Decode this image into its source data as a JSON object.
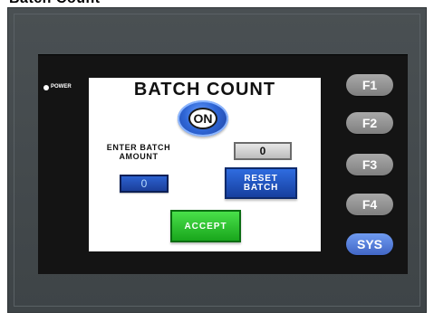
{
  "header_fragment": "Batch Count",
  "panel": {
    "power_label": "POWER",
    "screen": {
      "title": "BATCH COUNT",
      "on_label": "ON",
      "enter_label": "ENTER BATCH\nAMOUNT",
      "batch_amount_value": "0",
      "count_value": "0",
      "reset_label": "RESET\nBATCH",
      "accept_label": "ACCEPT"
    },
    "function_keys": [
      {
        "label": "F1"
      },
      {
        "label": "F2"
      },
      {
        "label": "F3"
      },
      {
        "label": "F4"
      },
      {
        "label": "SYS"
      }
    ]
  },
  "colors": {
    "device_frame": "#44494c",
    "on_button_blue": "#2f66d6",
    "accept_green": "#19a61c",
    "sys_blue": "#4f76d8",
    "fkey_gray": "#8f8f8f"
  }
}
